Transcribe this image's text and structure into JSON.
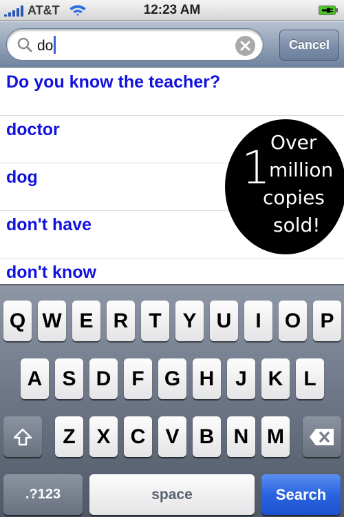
{
  "status_bar": {
    "carrier": "AT&T",
    "time": "12:23 AM",
    "signal_bars": 5,
    "wifi": true,
    "battery_state": "charging",
    "battery_color": "#4fc42a"
  },
  "search": {
    "query": "do",
    "cancel_label": "Cancel",
    "icons": {
      "search": "search-icon",
      "clear": "clear-icon"
    }
  },
  "results": [
    {
      "text": "Do you know the teacher?"
    },
    {
      "text": "doctor"
    },
    {
      "text": "dog"
    },
    {
      "text": "don't have"
    },
    {
      "text": "don't know"
    }
  ],
  "promo": {
    "number": "1",
    "line1": "Over",
    "line2": "million",
    "line3": "copies",
    "line4": "sold!"
  },
  "keyboard": {
    "row1": [
      "Q",
      "W",
      "E",
      "R",
      "T",
      "Y",
      "U",
      "I",
      "O",
      "P"
    ],
    "row2": [
      "A",
      "S",
      "D",
      "F",
      "G",
      "H",
      "J",
      "K",
      "L"
    ],
    "row3": [
      "Z",
      "X",
      "C",
      "V",
      "B",
      "N",
      "M"
    ],
    "shift_icon": "shift-icon",
    "delete_icon": "backspace-icon",
    "numbers_label": ".?123",
    "space_label": "space",
    "search_label": "Search",
    "accent_color": "#2a63e0"
  }
}
